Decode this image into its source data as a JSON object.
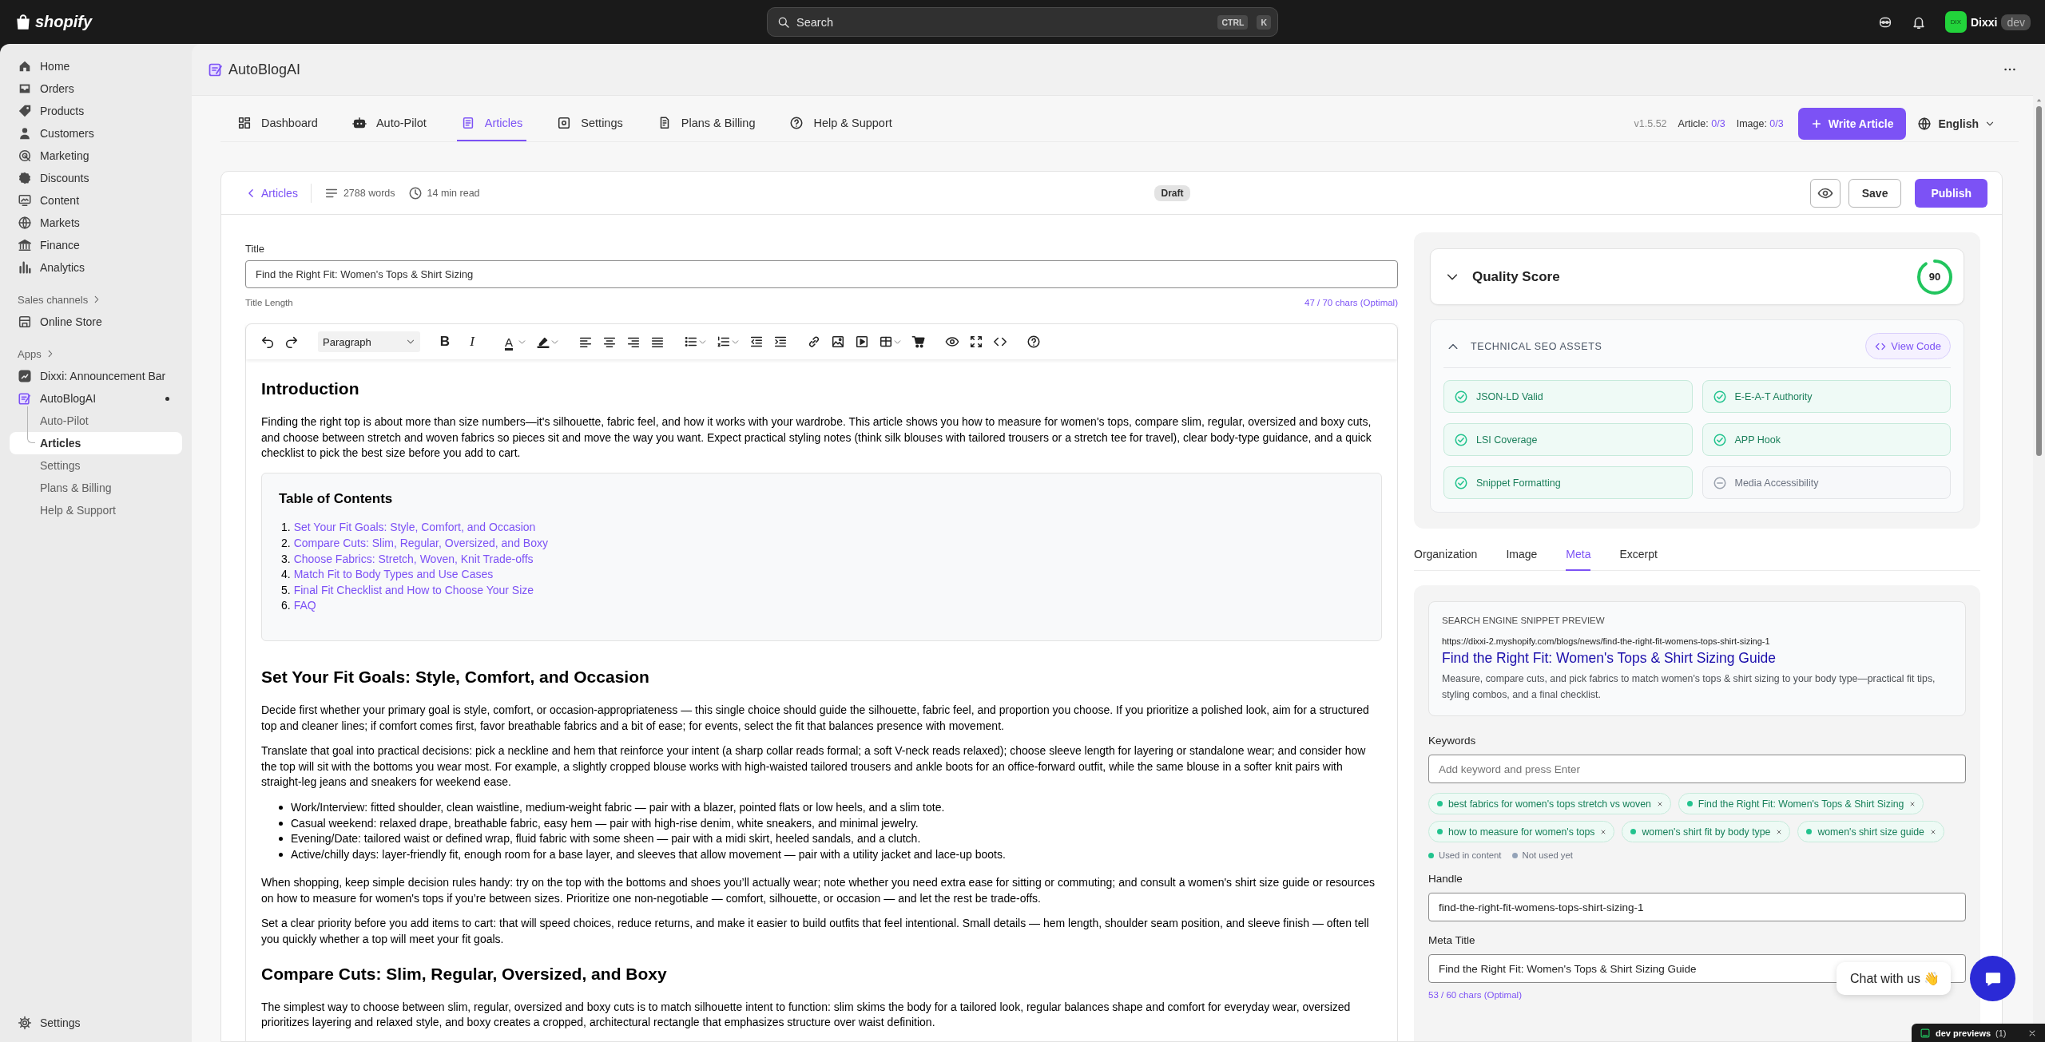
{
  "topbar": {
    "logo": "shopify",
    "search": {
      "placeholder": "Search",
      "keys": [
        "CTRL",
        "K"
      ]
    },
    "user": {
      "initials": "DIX",
      "name": "Dixxi",
      "badge": "dev"
    }
  },
  "sidebar": {
    "items": [
      {
        "label": "Home",
        "selected": false
      },
      {
        "label": "Orders",
        "selected": false
      },
      {
        "label": "Products",
        "selected": false
      },
      {
        "label": "Customers",
        "selected": false
      },
      {
        "label": "Marketing",
        "selected": false
      },
      {
        "label": "Discounts",
        "selected": false
      },
      {
        "label": "Content",
        "selected": false
      },
      {
        "label": "Markets",
        "selected": false
      },
      {
        "label": "Finance",
        "selected": false
      },
      {
        "label": "Analytics",
        "selected": false
      }
    ],
    "sales_channels": {
      "heading": "Sales channels",
      "items": [
        {
          "label": "Online Store",
          "selected": false
        }
      ]
    },
    "apps": {
      "heading": "Apps",
      "items": [
        {
          "label": "Dixxi: Announcement Bar",
          "selected": false
        },
        {
          "label": "AutoBlogAI",
          "selected": false,
          "children": [
            {
              "label": "Auto-Pilot",
              "selected": false
            },
            {
              "label": "Articles",
              "selected": true
            },
            {
              "label": "Settings",
              "selected": false
            },
            {
              "label": "Plans & Billing",
              "selected": false
            },
            {
              "label": "Help & Support",
              "selected": false
            }
          ]
        }
      ]
    },
    "footer": {
      "label": "Settings"
    }
  },
  "app": {
    "title": "AutoBlogAI",
    "tabs": [
      {
        "label": "Dashboard",
        "selected": false
      },
      {
        "label": "Auto-Pilot",
        "selected": false
      },
      {
        "label": "Articles",
        "selected": true
      },
      {
        "label": "Settings",
        "selected": false
      },
      {
        "label": "Plans & Billing",
        "selected": false
      },
      {
        "label": "Help & Support",
        "selected": false
      }
    ],
    "version": "v1.5.52",
    "quotas": [
      {
        "label": "Article:",
        "value": "0/3"
      },
      {
        "label": "Image:",
        "value": "0/3"
      }
    ],
    "write_button": "Write Article",
    "language": "English"
  },
  "editor": {
    "back": "Articles",
    "words": "2788 words",
    "read_time": "14 min read",
    "status": "Draft",
    "save": "Save",
    "publish": "Publish",
    "title_label": "Title",
    "title_value": "Find the Right Fit: Women's Tops & Shirt Sizing",
    "title_hint": "Title Length",
    "title_count": "47 / 70 chars (Optimal)",
    "toolbar": {
      "block_format": "Paragraph",
      "glyphs": [
        "B",
        "I",
        "A"
      ]
    },
    "content": [
      {
        "kind": "heading",
        "text": "Introduction"
      },
      {
        "kind": "paragraph",
        "text": "Finding the right top is about more than size numbers—it's silhouette, fabric feel, and how it works with your wardrobe. This article shows you how to measure for women's tops, compare slim, regular, oversized and boxy cuts, and choose between stretch and woven fabrics so pieces sit and move the way you want. Expect practical styling notes (think silk blouses with tailored trousers or a stretch tee for travel), clear body-type guidance, and a quick checklist to pick the best size before you add to cart."
      },
      {
        "kind": "toc",
        "title": "Table of Contents",
        "items": [
          {
            "number": "1.",
            "text": "Set Your Fit Goals: Style, Comfort, and Occasion"
          },
          {
            "number": "2.",
            "text": "Compare Cuts: Slim, Regular, Oversized, and Boxy"
          },
          {
            "number": "3.",
            "text": "Choose Fabrics: Stretch, Woven, Knit Trade-offs"
          },
          {
            "number": "4.",
            "text": "Match Fit to Body Types and Use Cases"
          },
          {
            "number": "5.",
            "text": "Final Fit Checklist and How to Choose Your Size"
          },
          {
            "number": "6.",
            "text": "FAQ"
          }
        ]
      },
      {
        "kind": "heading",
        "text": "Set Your Fit Goals: Style, Comfort, and Occasion"
      },
      {
        "kind": "paragraph",
        "text": "Decide first whether your primary goal is style, comfort, or occasion-appropriateness — this single choice should guide the silhouette, fabric feel, and proportion you choose. If you prioritize a polished look, aim for a structured top and cleaner lines; if comfort comes first, favor breathable fabrics and a bit of ease; for events, select the fit that balances presence with movement."
      },
      {
        "kind": "paragraph",
        "text": "Translate that goal into practical decisions: pick a neckline and hem that reinforce your intent (a sharp collar reads formal; a soft V-neck reads relaxed); choose sleeve length for layering or standalone wear; and consider how the top will sit with the bottoms you wear most. For example, a slightly cropped blouse works with high-waisted tailored trousers and ankle boots for an office-forward outfit, while the same blouse in a softer knit pairs with straight-leg jeans and sneakers for weekend ease."
      },
      {
        "kind": "bullets",
        "items": [
          "Work/Interview: fitted shoulder, clean waistline, medium-weight fabric — pair with a blazer, pointed flats or low heels, and a slim tote.",
          "Casual weekend: relaxed drape, breathable fabric, easy hem — pair with high-rise denim, white sneakers, and minimal jewelry.",
          "Evening/Date: tailored waist or defined wrap, fluid fabric with some sheen — pair with a midi skirt, heeled sandals, and a clutch.",
          "Active/chilly days: layer-friendly fit, enough room for a base layer, and sleeves that allow movement — pair with a utility jacket and lace-up boots."
        ]
      },
      {
        "kind": "paragraph",
        "text": "When shopping, keep simple decision rules handy: try on the top with the bottoms and shoes you’ll actually wear; note whether you need extra ease for sitting or commuting; and consult a women's shirt size guide or resources on how to measure for women's tops if you’re between sizes. Prioritize one non-negotiable — comfort, silhouette, or occasion — and let the rest be trade-offs."
      },
      {
        "kind": "paragraph",
        "text": "Set a clear priority before you add items to cart: that will speed choices, reduce returns, and make it easier to build outfits that feel intentional. Small details — hem length, shoulder seam position, and sleeve finish — often tell you quickly whether a top will meet your fit goals."
      },
      {
        "kind": "heading",
        "text": "Compare Cuts: Slim, Regular, Oversized, and Boxy"
      },
      {
        "kind": "paragraph",
        "text": "The simplest way to choose between slim, regular, oversized and boxy cuts is to match silhouette intent to function: slim skims the body for a tailored look, regular balances shape and comfort for everyday wear, oversized prioritizes layering and relaxed style, and boxy creates a cropped, architectural rectangle that emphasizes structure over waist definition."
      }
    ]
  },
  "quality": {
    "title": "Quality Score",
    "score": "90",
    "expanded": false
  },
  "seo": {
    "title": "TECHNICAL SEO ASSETS",
    "view_code": "View Code",
    "items": [
      {
        "label": "JSON-LD Valid",
        "passed": true
      },
      {
        "label": "E-E-A-T Authority",
        "passed": true
      },
      {
        "label": "LSI Coverage",
        "passed": true
      },
      {
        "label": "APP Hook",
        "passed": true
      },
      {
        "label": "Snippet Formatting",
        "passed": true
      },
      {
        "label": "Media Accessibility",
        "passed": false
      }
    ]
  },
  "side_tabs": [
    {
      "label": "Organization",
      "selected": false
    },
    {
      "label": "Image",
      "selected": false
    },
    {
      "label": "Meta",
      "selected": true
    },
    {
      "label": "Excerpt",
      "selected": false
    }
  ],
  "meta": {
    "snippet": {
      "heading": "SEARCH ENGINE SNIPPET PREVIEW",
      "url": "https://dixxi-2.myshopify.com/blogs/news/find-the-right-fit-womens-tops-shirt-sizing-1",
      "title": "Find the Right Fit: Women's Tops & Shirt Sizing Guide",
      "description": "Measure, compare cuts, and pick fabrics to match women's tops & shirt sizing to your body type—practical fit tips, styling combos, and a final checklist."
    },
    "keywords": {
      "label": "Keywords",
      "placeholder": "Add keyword and press Enter",
      "items": [
        {
          "text": "best fabrics for women's tops stretch vs woven",
          "used": true
        },
        {
          "text": "Find the Right Fit: Women's Tops & Shirt Sizing",
          "used": true
        },
        {
          "text": "how to measure for women's tops",
          "used": true
        },
        {
          "text": "women's shirt fit by body type",
          "used": true
        },
        {
          "text": "women's shirt size guide",
          "used": true
        }
      ],
      "legend": [
        {
          "label": "Used in content",
          "color": "#22c38e"
        },
        {
          "label": "Not used yet",
          "color": "#94a3b8"
        }
      ]
    },
    "handle": {
      "label": "Handle",
      "value": "find-the-right-fit-womens-tops-shirt-sizing-1"
    },
    "meta_title": {
      "label": "Meta Title",
      "value": "Find the Right Fit: Women's Tops & Shirt Sizing Guide",
      "count": "53 / 60 chars (Optimal)"
    }
  },
  "chat": {
    "label": "Chat with us 👋"
  },
  "dev_bar": {
    "label": "dev previews",
    "count": "(1)"
  }
}
